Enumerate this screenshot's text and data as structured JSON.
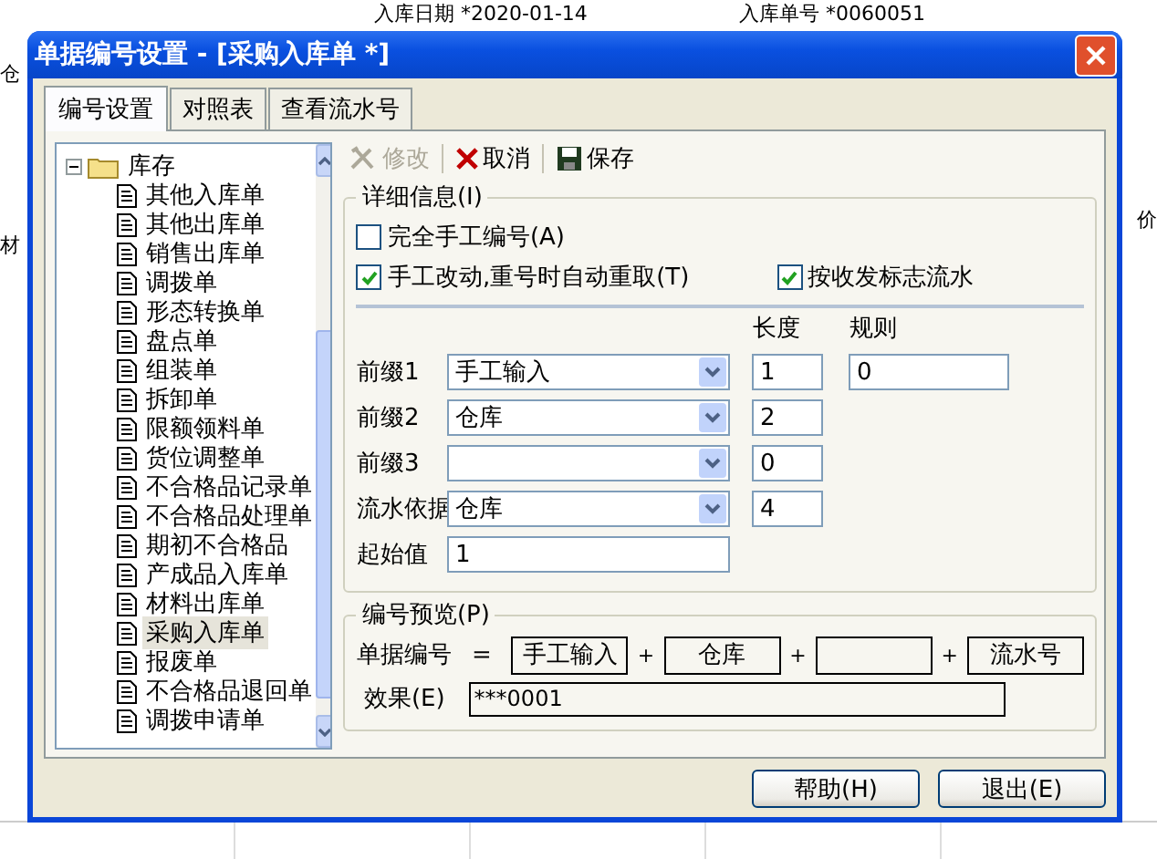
{
  "background": {
    "header": [
      {
        "text": "入库日期 *2020-01-14"
      },
      {
        "text": "入库单号 *0060051"
      }
    ],
    "side_left": [
      {
        "text": "仓"
      },
      {
        "text": "材"
      }
    ],
    "side_right": [
      {
        "text": "价"
      }
    ]
  },
  "dialog": {
    "title": "单据编号设置 - [采购入库单 *]",
    "tabs": [
      {
        "label": "编号设置",
        "selected": true
      },
      {
        "label": "对照表",
        "selected": false
      },
      {
        "label": "查看流水号",
        "selected": false
      }
    ]
  },
  "tree": {
    "items": [
      {
        "label": "库存",
        "expanded": true,
        "children": [
          {
            "label": "其他入库单",
            "selected": false
          },
          {
            "label": "其他出库单",
            "selected": false
          },
          {
            "label": "销售出库单",
            "selected": false
          },
          {
            "label": "调拨单",
            "selected": false
          },
          {
            "label": "形态转换单",
            "selected": false
          },
          {
            "label": "盘点单",
            "selected": false
          },
          {
            "label": "组装单",
            "selected": false
          },
          {
            "label": "拆卸单",
            "selected": false
          },
          {
            "label": "限额领料单",
            "selected": false
          },
          {
            "label": "货位调整单",
            "selected": false
          },
          {
            "label": "不合格品记录单",
            "selected": false
          },
          {
            "label": "不合格品处理单",
            "selected": false
          },
          {
            "label": "期初不合格品",
            "selected": false
          },
          {
            "label": "产成品入库单",
            "selected": false
          },
          {
            "label": "材料出库单",
            "selected": false
          },
          {
            "label": "采购入库单",
            "selected": true
          },
          {
            "label": "报废单",
            "selected": false
          },
          {
            "label": "不合格品退回单",
            "selected": false
          },
          {
            "label": "调拨申请单",
            "selected": false
          }
        ]
      }
    ]
  },
  "toolbar": [
    {
      "label": "修改",
      "disabled": true
    },
    {
      "label": "取消",
      "disabled": false
    },
    {
      "label": "保存",
      "disabled": false
    }
  ],
  "details": {
    "title": "详细信息(I)",
    "checkboxes": [
      {
        "label": "完全手工编号(A)",
        "checked": false
      },
      {
        "label": "手工改动,重号时自动重取(T)",
        "checked": true
      },
      {
        "label": "按收发标志流水",
        "checked": true
      }
    ],
    "length_header": "长度",
    "rule_header": "规则",
    "rows": [
      {
        "label": "前缀1",
        "kind": "select",
        "value": "手工输入",
        "length": "1",
        "rule": "0"
      },
      {
        "label": "前缀2",
        "kind": "select",
        "value": "仓库",
        "length": "2"
      },
      {
        "label": "前缀3",
        "kind": "select",
        "length": "0"
      },
      {
        "label": "流水依据",
        "kind": "select",
        "value": "仓库",
        "length": "4"
      },
      {
        "label": "起始值",
        "kind": "text",
        "value": "1"
      }
    ]
  },
  "preview": {
    "title": "编号预览(P)",
    "label": "单据编号",
    "equals": "=",
    "parts": [
      {
        "text": "手工输入"
      },
      {
        "joiner": "+",
        "text": "仓库"
      },
      {
        "joiner": "+"
      },
      {
        "joiner": "+",
        "text": "流水号"
      }
    ],
    "effect_label": "效果(E)",
    "effect_value": "***0001"
  },
  "buttons": [
    {
      "label": "帮助(H)"
    },
    {
      "label": "退出(E)"
    }
  ]
}
